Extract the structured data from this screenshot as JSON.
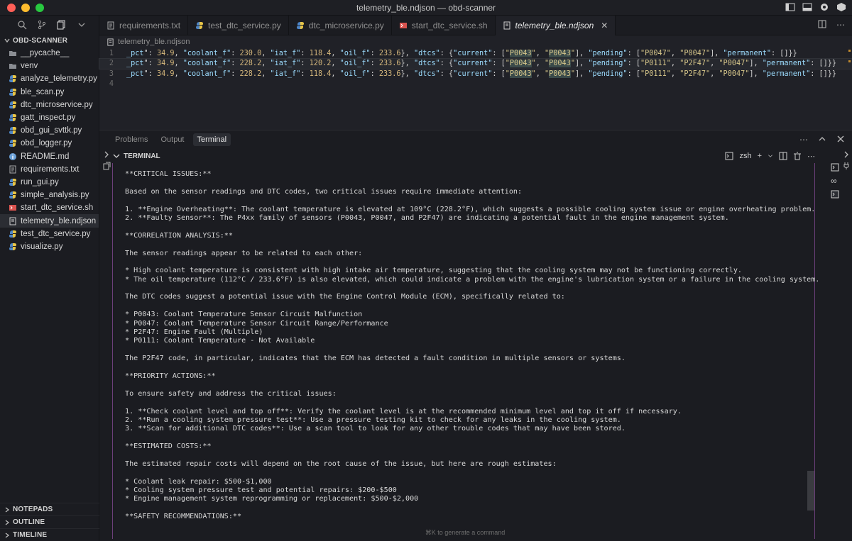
{
  "window": {
    "title": "telemetry_ble.ndjson — obd-scanner"
  },
  "explorer": {
    "root": "OBD-SCANNER",
    "files": [
      {
        "name": "__pycache__",
        "type": "folder"
      },
      {
        "name": "venv",
        "type": "folder"
      },
      {
        "name": "analyze_telemetry.py",
        "type": "python"
      },
      {
        "name": "ble_scan.py",
        "type": "python"
      },
      {
        "name": "dtc_microservice.py",
        "type": "python"
      },
      {
        "name": "gatt_inspect.py",
        "type": "python"
      },
      {
        "name": "obd_gui_svttk.py",
        "type": "python"
      },
      {
        "name": "obd_logger.py",
        "type": "python"
      },
      {
        "name": "README.md",
        "type": "info"
      },
      {
        "name": "requirements.txt",
        "type": "text"
      },
      {
        "name": "run_gui.py",
        "type": "python"
      },
      {
        "name": "simple_analysis.py",
        "type": "python"
      },
      {
        "name": "start_dtc_service.sh",
        "type": "shell"
      },
      {
        "name": "telemetry_ble.ndjson",
        "type": "json"
      },
      {
        "name": "test_dtc_service.py",
        "type": "python"
      },
      {
        "name": "visualize.py",
        "type": "python"
      }
    ],
    "sections": [
      "NOTEPADS",
      "OUTLINE",
      "TIMELINE"
    ]
  },
  "tabs": [
    {
      "label": "requirements.txt",
      "type": "text"
    },
    {
      "label": "test_dtc_service.py",
      "type": "python"
    },
    {
      "label": "dtc_microservice.py",
      "type": "python"
    },
    {
      "label": "start_dtc_service.sh",
      "type": "shell"
    },
    {
      "label": "telemetry_ble.ndjson",
      "type": "json",
      "active": true
    }
  ],
  "editor": {
    "breadcrumb": "telemetry_ble.ndjson",
    "line_numbers": [
      "1",
      "2",
      "3",
      "4"
    ],
    "lines": [
      {
        "oil_pct": "34.9",
        "coolant_f": "230.0",
        "iat_f": "118.4",
        "oil_f": "233.6",
        "current": [
          "P0043",
          "P0043"
        ],
        "pending": [
          "P0047",
          "P0047"
        ]
      },
      {
        "oil_pct": "34.9",
        "coolant_f": "228.2",
        "iat_f": "120.2",
        "oil_f": "233.6",
        "current": [
          "P0043",
          "P0043"
        ],
        "pending": [
          "P0111",
          "P2F47",
          "P0047"
        ]
      },
      {
        "oil_pct": "34.9",
        "coolant_f": "228.2",
        "iat_f": "118.4",
        "oil_f": "233.6",
        "current": [
          "P0043",
          "P0043"
        ],
        "pending": [
          "P0111",
          "P2F47",
          "P0047"
        ]
      }
    ]
  },
  "panel": {
    "tabs": [
      "Problems",
      "Output",
      "Terminal"
    ],
    "active_tab": "Terminal",
    "terminal_label": "TERMINAL",
    "shell": "zsh",
    "hint": "⌘K to generate a command",
    "output": [
      "**CRITICAL ISSUES:**",
      "",
      "Based on the sensor readings and DTC codes, two critical issues require immediate attention:",
      "",
      "1. **Engine Overheating**: The coolant temperature is elevated at 109°C (228.2°F), which suggests a possible cooling system issue or engine overheating problem.",
      "2. **Faulty Sensor**: The P4xx family of sensors (P0043, P0047, and P2F47) are indicating a potential fault in the engine management system.",
      "",
      "**CORRELATION ANALYSIS:**",
      "",
      "The sensor readings appear to be related to each other:",
      "",
      "* High coolant temperature is consistent with high intake air temperature, suggesting that the cooling system may not be functioning correctly.",
      "* The oil temperature (112°C / 233.6°F) is also elevated, which could indicate a problem with the engine's lubrication system or a failure in the cooling system.",
      "",
      "The DTC codes suggest a potential issue with the Engine Control Module (ECM), specifically related to:",
      "",
      "* P0043: Coolant Temperature Sensor Circuit Malfunction",
      "* P0047: Coolant Temperature Sensor Circuit Range/Performance",
      "* P2F47: Engine Fault (Multiple)",
      "* P0111: Coolant Temperature - Not Available",
      "",
      "The P2F47 code, in particular, indicates that the ECM has detected a fault condition in multiple sensors or systems.",
      "",
      "**PRIORITY ACTIONS:**",
      "",
      "To ensure safety and address the critical issues:",
      "",
      "1. **Check coolant level and top off**: Verify the coolant level is at the recommended minimum level and top it off if necessary.",
      "2. **Run a cooling system pressure test**: Use a pressure testing kit to check for any leaks in the cooling system.",
      "3. **Scan for additional DTC codes**: Use a scan tool to look for any other trouble codes that may have been stored.",
      "",
      "**ESTIMATED COSTS:**",
      "",
      "The estimated repair costs will depend on the root cause of the issue, but here are rough estimates:",
      "",
      "* Coolant leak repair: $500-$1,000",
      "* Cooling system pressure test and potential repairs: $200-$500",
      "* Engine management system reprogramming or replacement: $500-$2,000",
      "",
      "**SAFETY RECOMMENDATIONS:**"
    ]
  },
  "colors": {
    "python_icon": "#4f86c6",
    "shell_icon": "#d9534f",
    "json_icon": "#cfcfcf",
    "frame_accent": "#6b3f7a"
  }
}
